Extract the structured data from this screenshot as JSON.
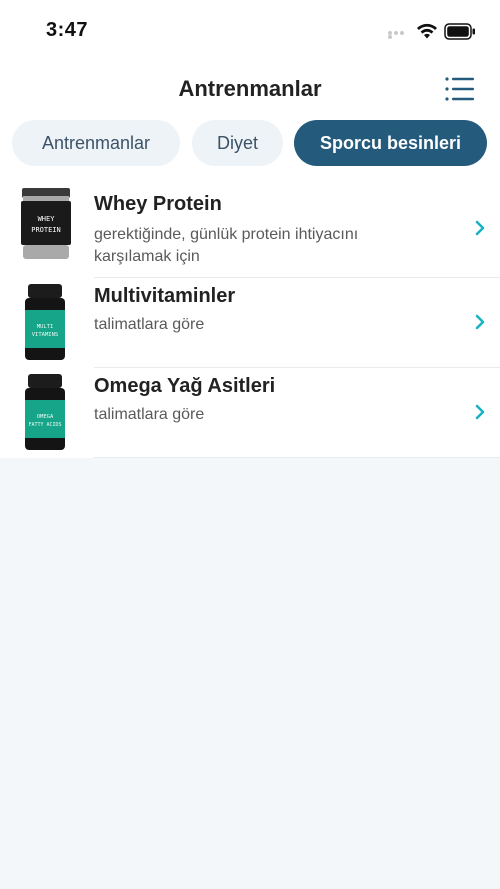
{
  "status_bar": {
    "time": "3:47"
  },
  "header": {
    "title": "Antrenmanlar",
    "menu_icon": "list-menu-icon"
  },
  "tabs": [
    {
      "label": "Antrenmanlar",
      "active": false
    },
    {
      "label": "Diyet",
      "active": false
    },
    {
      "label": "Sporcu besinleri",
      "active": true
    }
  ],
  "colors": {
    "accent": "#245a7c",
    "chevron": "#1ab3c2",
    "tab_bg": "#eef3f8",
    "supplement_green": "#17a589"
  },
  "items": [
    {
      "title": "Whey Protein",
      "subtitle": "gerektiğinde, günlük protein ihtiyacını karşılamak için",
      "label_line1": "WHEY",
      "label_line2": "PROTEIN"
    },
    {
      "title": "Multivitaminler",
      "subtitle": "talimatlara göre",
      "label_line1": "MULTI",
      "label_line2": "VITAMINS"
    },
    {
      "title": "Omega Yağ Asitleri",
      "subtitle": "talimatlara göre",
      "label_line1": "OMEGA",
      "label_line2": "FATTY ACIDS"
    }
  ]
}
